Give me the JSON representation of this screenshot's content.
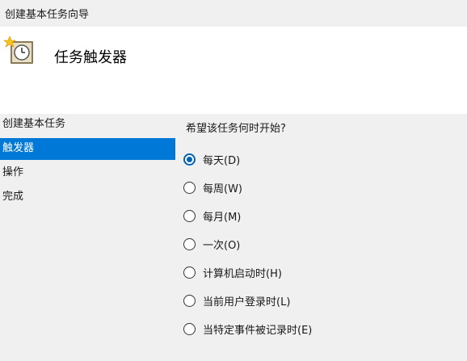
{
  "window": {
    "title": "创建基本任务向导"
  },
  "header": {
    "title": "任务触发器",
    "icon": "clock-task-icon"
  },
  "sidebar": {
    "items": [
      {
        "label": "创建基本任务",
        "active": false
      },
      {
        "label": "触发器",
        "active": true
      },
      {
        "label": "操作",
        "active": false
      },
      {
        "label": "完成",
        "active": false
      }
    ]
  },
  "content": {
    "question": "希望该任务何时开始?",
    "options": [
      {
        "label": "每天(D)",
        "checked": true
      },
      {
        "label": "每周(W)",
        "checked": false
      },
      {
        "label": "每月(M)",
        "checked": false
      },
      {
        "label": "一次(O)",
        "checked": false
      },
      {
        "label": "计算机启动时(H)",
        "checked": false
      },
      {
        "label": "当前用户登录时(L)",
        "checked": false
      },
      {
        "label": "当特定事件被记录时(E)",
        "checked": false
      }
    ]
  },
  "colors": {
    "accent": "#0078d7",
    "radio": "#0063b1",
    "header_bg": "#ffffff",
    "body_bg": "#f0f0f0"
  }
}
